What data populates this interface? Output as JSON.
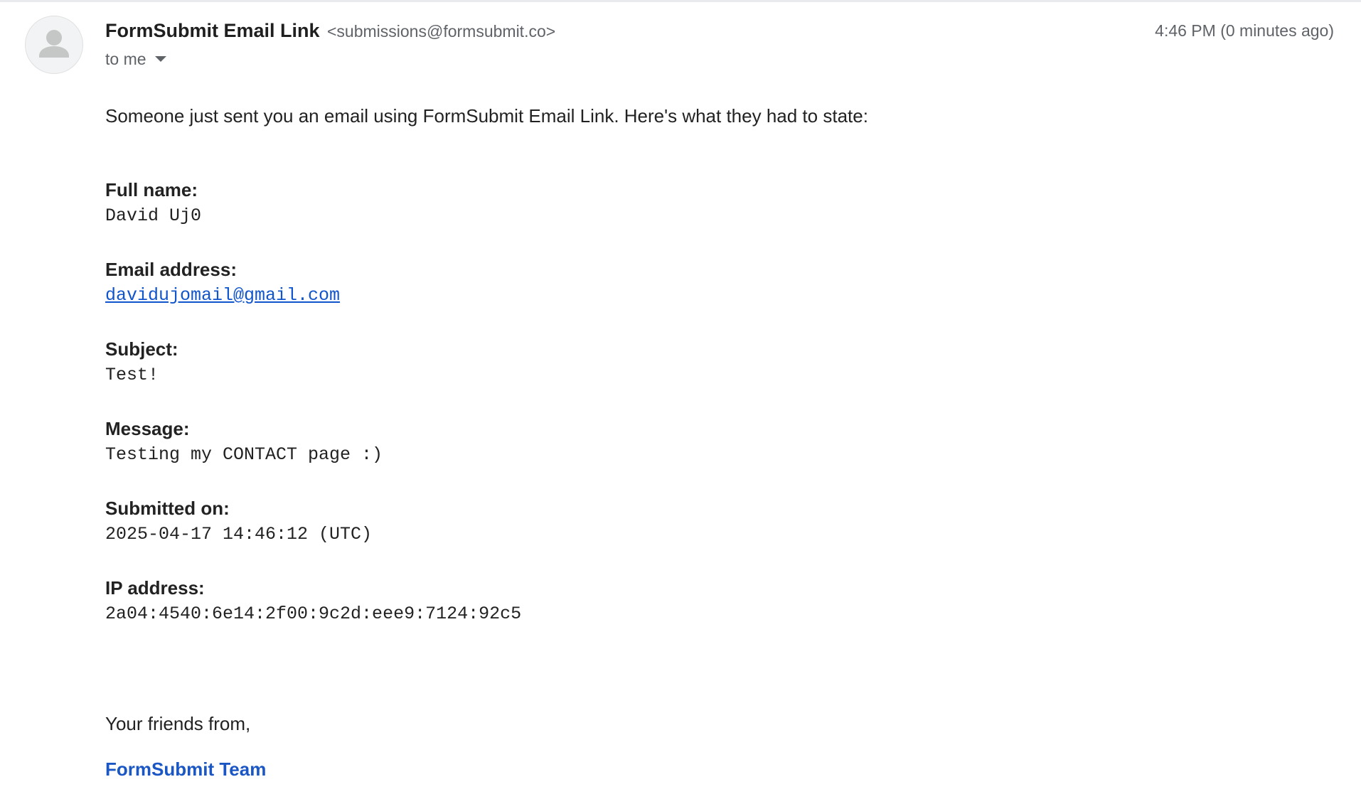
{
  "message": {
    "sender_name": "FormSubmit Email Link",
    "sender_email": "<submissions@formsubmit.co>",
    "timestamp": "4:46 PM (0 minutes ago)",
    "recipients": "to me",
    "avatar_icon": "person-icon",
    "dropdown_icon": "caret-down-icon"
  },
  "body": {
    "intro": "Someone just sent you an email using FormSubmit Email Link. Here's what they had to state:",
    "fields": [
      {
        "label": "Full name:",
        "value": "David Uj0"
      },
      {
        "label": "Email address:",
        "value": "davidujomail@gmail.com"
      },
      {
        "label": "Subject:",
        "value": "Test!"
      },
      {
        "label": "Message:",
        "value": "Testing my CONTACT page :)"
      },
      {
        "label": "Submitted on:",
        "value": "2025-04-17 14:46:12 (UTC)"
      },
      {
        "label": "IP address:",
        "value": "2a04:4540:6e14:2f00:9c2d:eee9:7124:92c5"
      }
    ],
    "signoff": "Your friends from,",
    "team": "FormSubmit Team"
  },
  "colors": {
    "link": "#1155cc",
    "team": "#1a56c4",
    "muted": "#5f6368",
    "text": "#222222"
  }
}
